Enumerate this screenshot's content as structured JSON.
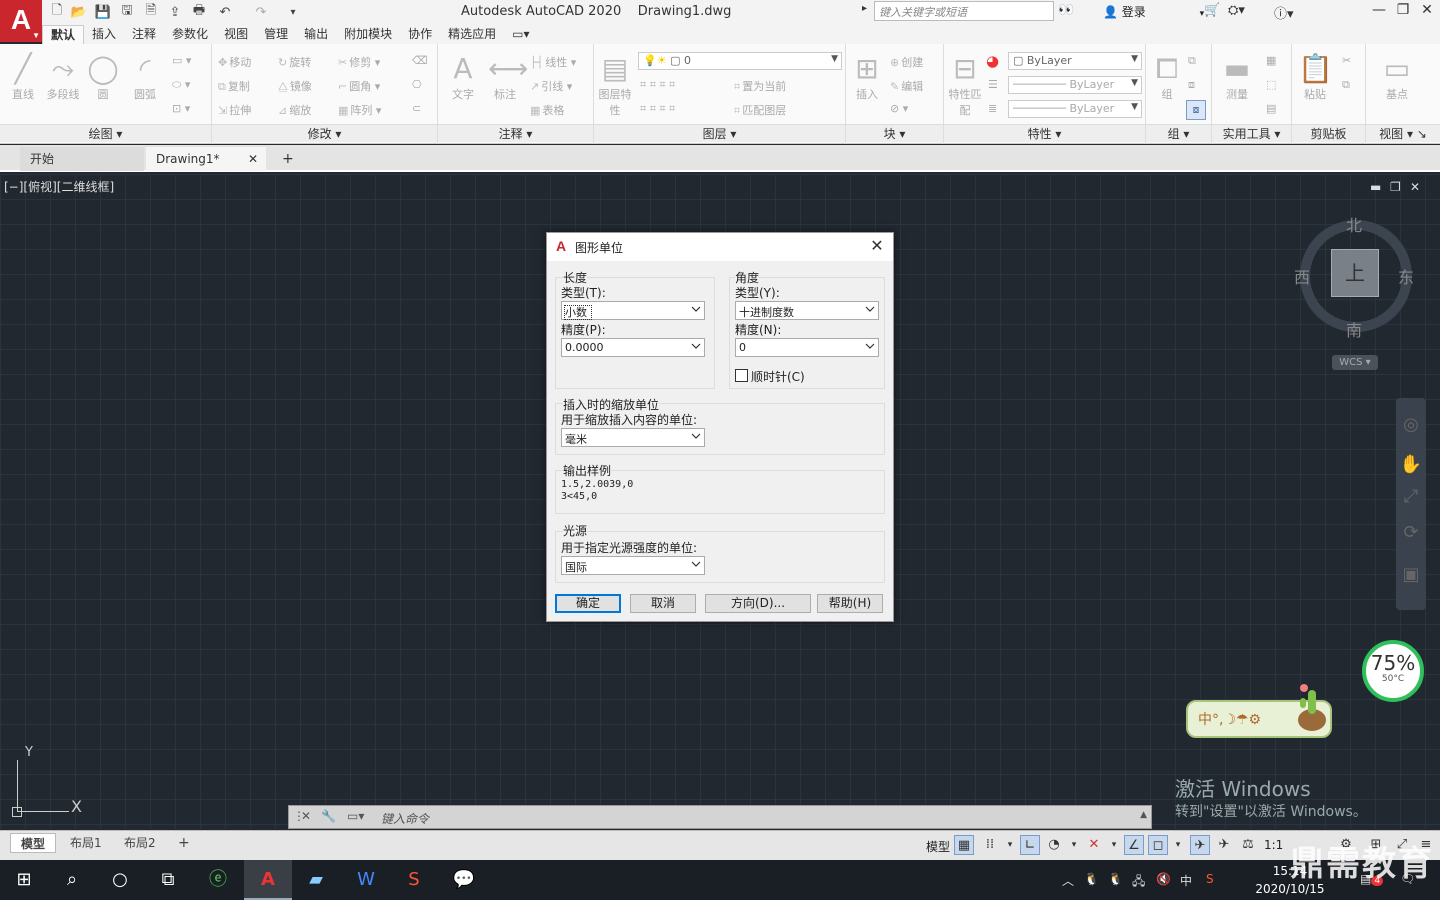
{
  "titlebar": {
    "title": "Autodesk AutoCAD 2020",
    "filename": "Drawing1.dwg",
    "search_placeholder": "键入关键字或短语",
    "login": "登录",
    "app_letter": "A"
  },
  "ribbon_tabs": [
    "默认",
    "插入",
    "注释",
    "参数化",
    "视图",
    "管理",
    "输出",
    "附加模块",
    "协作",
    "精选应用"
  ],
  "ribbon": {
    "draw": {
      "title": "绘图",
      "line": "直线",
      "polyline": "多段线",
      "circle": "圆",
      "arc": "圆弧"
    },
    "modify": {
      "title": "修改",
      "move": "移动",
      "rotate": "旋转",
      "trim": "修剪",
      "copy": "复制",
      "mirror": "镜像",
      "fillet": "圆角",
      "stretch": "拉伸",
      "scale": "缩放",
      "array": "阵列"
    },
    "annotate": {
      "title": "注释",
      "text": "文字",
      "dimension": "标注",
      "linear": "线性",
      "leader": "引线",
      "table": "表格"
    },
    "layers": {
      "title": "图层",
      "layer_props": "图层特性",
      "layer_value": "0",
      "set_current": "置为当前",
      "match_layer": "匹配图层"
    },
    "block": {
      "title": "块",
      "insert": "插入",
      "create": "创建",
      "edit": "编辑"
    },
    "properties": {
      "title": "特性",
      "match": "特性匹配",
      "color": "ByLayer",
      "linetype": "ByLayer",
      "lineweight": "ByLayer"
    },
    "groups": {
      "title": "组",
      "group": "组"
    },
    "utilities": {
      "title": "实用工具",
      "measure": "测量"
    },
    "clipboard": {
      "title": "剪贴板",
      "paste": "粘贴"
    },
    "view": {
      "title": "视图",
      "base": "基点"
    }
  },
  "doc_tabs": {
    "start": "开始",
    "drawing": "Drawing1*"
  },
  "viewport": {
    "label": "[−][俯视][二维线框]"
  },
  "viewcube": {
    "north": "北",
    "south": "南",
    "east": "东",
    "west": "西",
    "top": "上",
    "wcs": "WCS"
  },
  "ucs": {
    "x": "X",
    "y": "Y"
  },
  "dialog": {
    "title": "图形单位",
    "length": {
      "group": "长度",
      "type_label": "类型(T):",
      "type_value": "小数",
      "precision_label": "精度(P):",
      "precision_value": "0.0000"
    },
    "angle": {
      "group": "角度",
      "type_label": "类型(Y):",
      "type_value": "十进制度数",
      "precision_label": "精度(N):",
      "precision_value": "0",
      "clockwise": "顺时针(C)"
    },
    "insertion": {
      "group": "插入时的缩放单位",
      "label": "用于缩放插入内容的单位:",
      "value": "毫米"
    },
    "sample": {
      "group": "输出样例",
      "line1": "1.5,2.0039,0",
      "line2": "3<45,0"
    },
    "lighting": {
      "group": "光源",
      "label": "用于指定光源强度的单位:",
      "value": "国际"
    },
    "buttons": {
      "ok": "确定",
      "cancel": "取消",
      "direction": "方向(D)...",
      "help": "帮助(H)"
    }
  },
  "command": {
    "placeholder": "键入命令"
  },
  "layout_tabs": [
    "模型",
    "布局1",
    "布局2"
  ],
  "status": {
    "model": "模型",
    "scale": "1:1"
  },
  "widgets": {
    "cpu": "75%",
    "temp": "50°C",
    "ime": "中°,☽☂⚙"
  },
  "activation": {
    "line1": "激活 Windows",
    "line2": "转到\"设置\"以激活 Windows。"
  },
  "watermark": "鼎需教育",
  "clock": {
    "time": "15:14",
    "date": "2020/10/15"
  },
  "tray": {
    "lang": "中",
    "notif": "4"
  }
}
